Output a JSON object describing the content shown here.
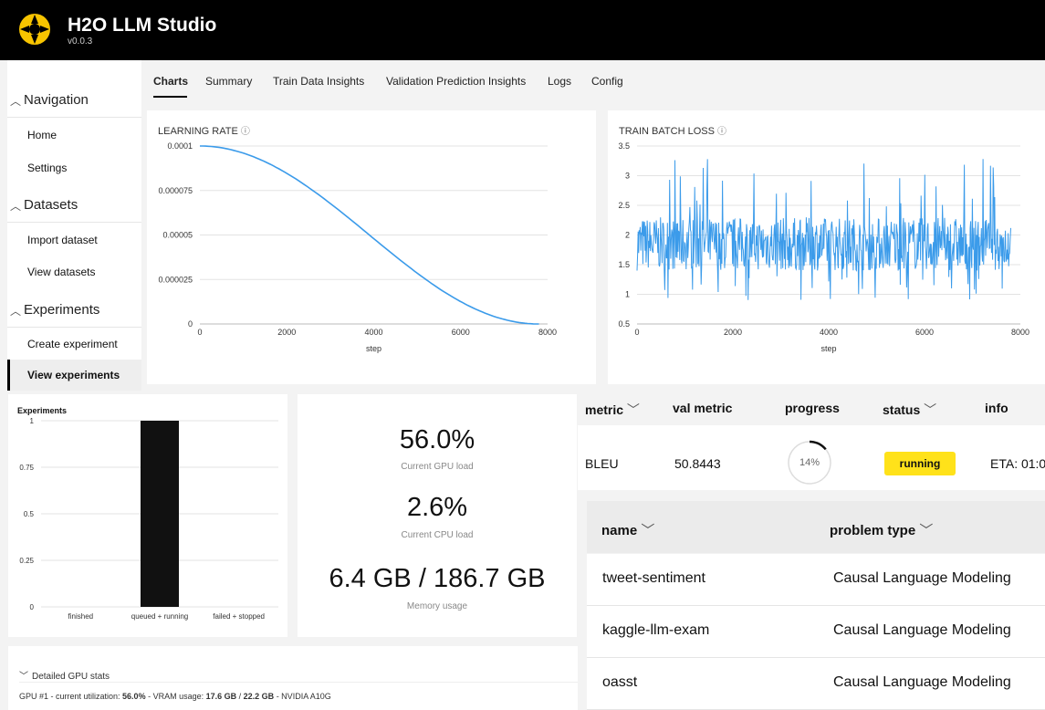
{
  "app": {
    "title": "H2O LLM Studio",
    "version": "v0.0.3"
  },
  "sidebar": {
    "sections": [
      {
        "label": "Navigation",
        "items": [
          "Home",
          "Settings"
        ]
      },
      {
        "label": "Datasets",
        "items": [
          "Import dataset",
          "View datasets"
        ]
      },
      {
        "label": "Experiments",
        "items": [
          "Create experiment",
          "View experiments"
        ]
      }
    ],
    "active_item": "View experiments"
  },
  "tabs": [
    "Charts",
    "Summary",
    "Train Data Insights",
    "Validation Prediction Insights",
    "Logs",
    "Config"
  ],
  "active_tab": "Charts",
  "lr_chart": {
    "title": "LEARNING RATE",
    "xlabel": "step"
  },
  "loss_chart": {
    "title": "TRAIN BATCH LOSS",
    "xlabel": "step"
  },
  "exp_chart": {
    "title": "Experiments"
  },
  "stats": {
    "gpu_value": "56.0%",
    "gpu_label": "Current GPU load",
    "cpu_value": "2.6%",
    "cpu_label": "Current CPU load",
    "mem_value": "6.4 GB / 186.7 GB",
    "mem_label": "Memory usage"
  },
  "gpu_details": {
    "toggle": "Detailed GPU stats",
    "line_prefix": "GPU #1 - current utilization: ",
    "util": "56.0%",
    "vram_prefix": " - VRAM usage: ",
    "vram_used": "17.6 GB",
    "sep": " / ",
    "vram_total": "22.2 GB",
    "device": " - NVIDIA A10G"
  },
  "metric_table": {
    "headers": {
      "metric": "metric",
      "val_metric": "val metric",
      "progress": "progress",
      "status": "status",
      "info": "info"
    },
    "row": {
      "metric": "BLEU",
      "val_metric": "50.8443",
      "progress": "14%",
      "progress_fraction": 0.14,
      "status": "running",
      "info": "ETA: 01:0"
    }
  },
  "experiments_table": {
    "headers": {
      "name": "name",
      "problem_type": "problem type"
    },
    "rows": [
      {
        "name": "tweet-sentiment",
        "problem_type": "Causal Language Modeling"
      },
      {
        "name": "kaggle-llm-exam",
        "problem_type": "Causal Language Modeling"
      },
      {
        "name": "oasst",
        "problem_type": "Causal Language Modeling"
      }
    ]
  },
  "colors": {
    "accent": "#3b9bea",
    "status_running": "#ffe21a",
    "bar": "#111111"
  },
  "chart_data": [
    {
      "type": "line",
      "title": "LEARNING RATE",
      "xlabel": "step",
      "ylabel": "",
      "x_ticks": [
        "0",
        "2000",
        "4000",
        "6000",
        "8000"
      ],
      "y_ticks": [
        "0",
        "0.000025",
        "0.00005",
        "0.000075",
        "0.0001"
      ],
      "xlim": [
        0,
        8000
      ],
      "ylim": [
        0,
        0.0001
      ],
      "x": [
        0,
        1000,
        2000,
        3000,
        4000,
        5000,
        6000,
        7000,
        7800
      ],
      "y": [
        0.0001,
        9.62e-05,
        8.53e-05,
        6.91e-05,
        5e-05,
        3.09e-05,
        1.47e-05,
        3.8e-06,
        0.0
      ]
    },
    {
      "type": "line",
      "title": "TRAIN BATCH LOSS",
      "xlabel": "step",
      "ylabel": "",
      "x_ticks": [
        "0",
        "2000",
        "4000",
        "6000",
        "8000"
      ],
      "y_ticks": [
        "0.5",
        "1",
        "1.5",
        "2",
        "2.5",
        "3",
        "3.5"
      ],
      "xlim": [
        0,
        8000
      ],
      "ylim": [
        0.5,
        3.5
      ],
      "x": [
        0,
        7800
      ],
      "y_range": [
        0.9,
        3.3
      ],
      "y_mean": 1.85
    },
    {
      "type": "bar",
      "title": "Experiments",
      "categories": [
        "finished",
        "queued + running",
        "failed + stopped"
      ],
      "values": [
        0,
        1,
        0
      ],
      "y_ticks": [
        "0",
        "0.25",
        "0.5",
        "0.75",
        "1"
      ],
      "ylim": [
        0,
        1
      ]
    }
  ]
}
